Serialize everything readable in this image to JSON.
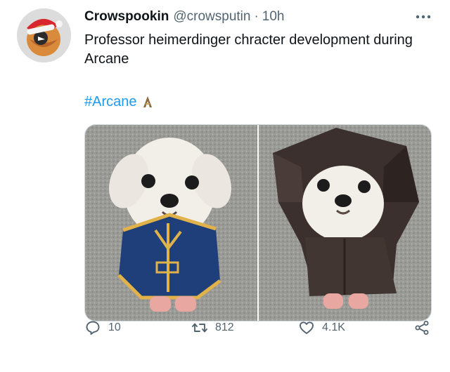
{
  "author": {
    "display_name": "Crowspookin",
    "handle": "@crowsputin",
    "separator": "·",
    "time": "10h"
  },
  "tweet": {
    "text": "Professor heimerdinger chracter development during Arcane",
    "hashtag": "#Arcane",
    "hashtag_emoji_icon": "arcane-hashflag-icon"
  },
  "media": [
    {
      "icon": "dog-in-blue-coat-photo"
    },
    {
      "icon": "dog-in-dark-hood-photo"
    }
  ],
  "actions": {
    "reply_count": "10",
    "retweet_count": "812",
    "like_count": "4.1K"
  },
  "colors": {
    "link": "#1d9bf0",
    "secondary_text": "#536471",
    "primary_text": "#0f1419"
  }
}
